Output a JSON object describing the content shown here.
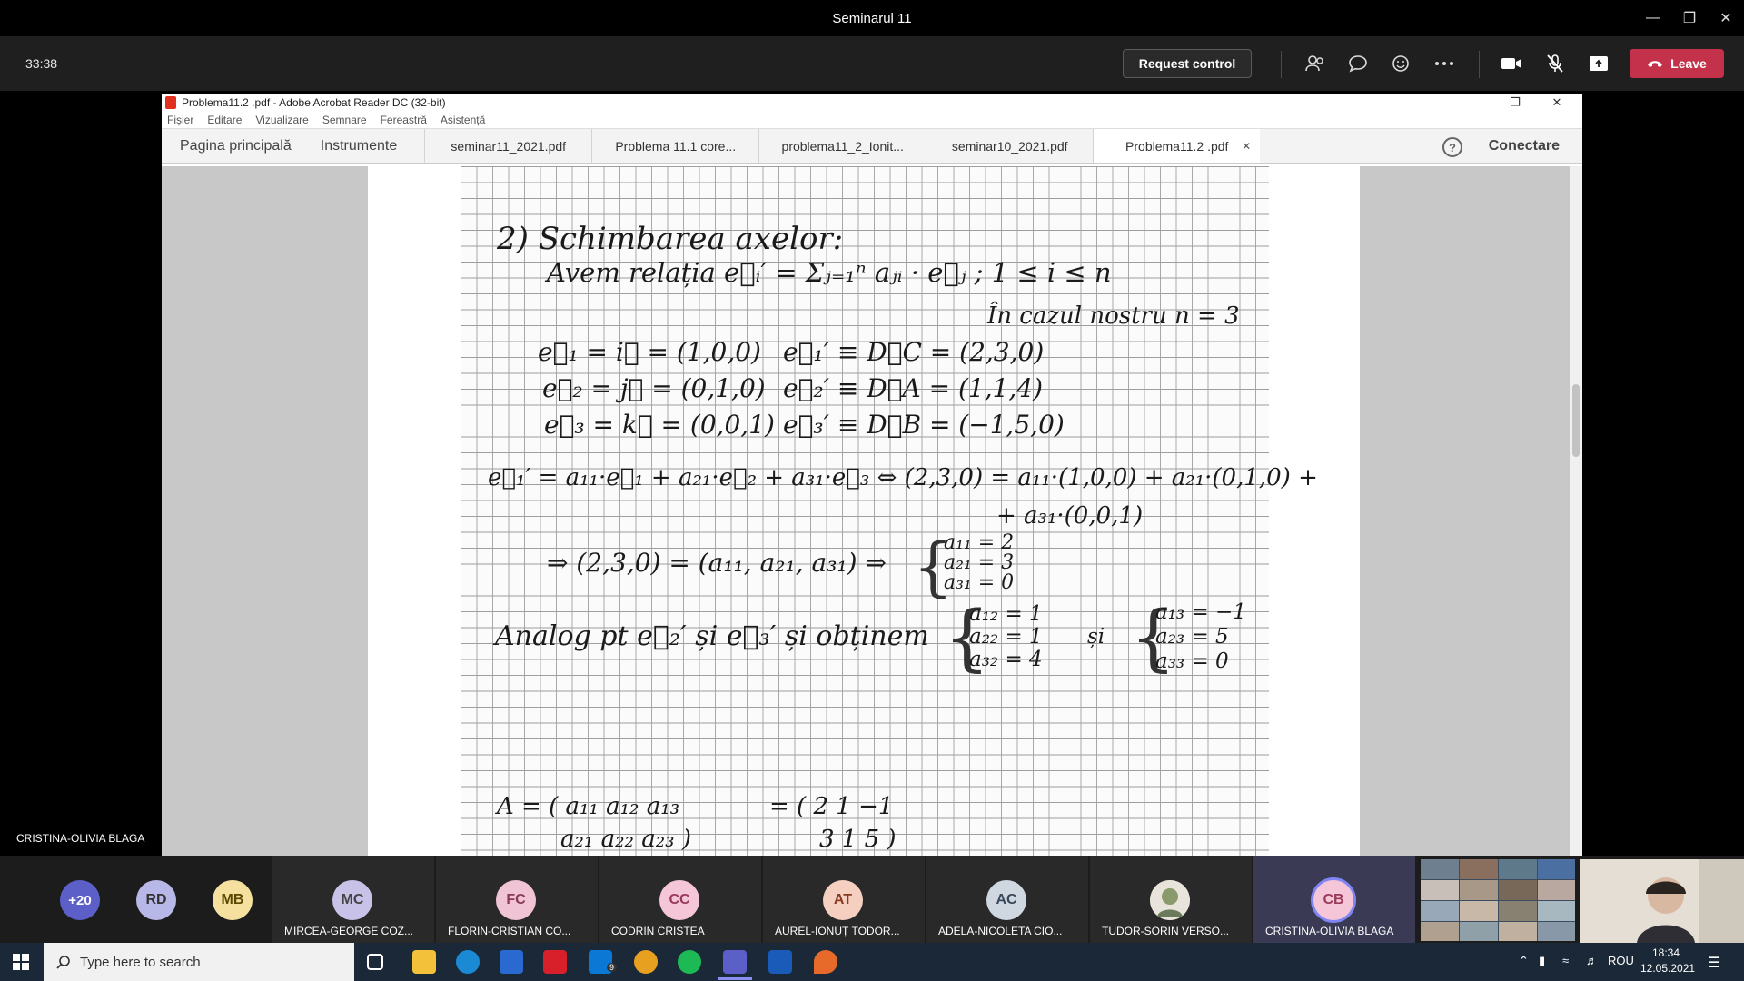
{
  "window": {
    "title": "Seminarul 11"
  },
  "meeting": {
    "timer": "33:38",
    "request_control": "Request control",
    "leave": "Leave",
    "presenter_name": "CRISTINA-OLIVIA BLAGA"
  },
  "acrobat": {
    "title": "Problema11.2 .pdf - Adobe Acrobat Reader DC (32-bit)",
    "menu": [
      "Fișier",
      "Editare",
      "Vizualizare",
      "Semnare",
      "Fereastră",
      "Asistență"
    ],
    "nav": [
      "Pagina principală",
      "Instrumente"
    ],
    "tabs": [
      "seminar11_2021.pdf",
      "Problema 11.1 core...",
      "problema11_2_Ionit...",
      "seminar10_2021.pdf",
      "Problema11.2 .pdf"
    ],
    "help": "?",
    "connect": "Conectare"
  },
  "handwriting": [
    "2) Schimbarea axelor:",
    "Avem relația   e⃗ᵢ′ = Σⱼ₌₁ⁿ aⱼᵢ · e⃗ⱼ   ;  1 ≤ i ≤ n",
    "În cazul nostru  n = 3",
    "e⃗₁ = i⃗ = (1,0,0)",
    "e⃗₂ = j⃗ = (0,1,0)",
    "e⃗₃ = k⃗ = (0,0,1)",
    "e⃗₁′ ≡ D⃗C = (2,3,0)",
    "e⃗₂′ ≡ D⃗A = (1,1,4)",
    "e⃗₃′ ≡ D⃗B = (−1,5,0)",
    "e⃗₁′ = a₁₁·e⃗₁ + a₂₁·e⃗₂ + a₃₁·e⃗₃ ⇔ (2,3,0) = a₁₁·(1,0,0) + a₂₁·(0,1,0) +",
    "+ a₃₁·(0,0,1)",
    "⇒ (2,3,0) = (a₁₁, a₂₁, a₃₁) ⇒",
    "a₁₁ = 2",
    "a₂₁ = 3",
    "a₃₁ = 0",
    "Analog pt e⃗₂′ și e⃗₃′ și obținem",
    "a₁₂ = 1",
    "a₂₂ = 1",
    "a₃₂ = 4",
    "și",
    "a₁₃ = −1",
    "a₂₃ = 5",
    "a₃₃ = 0",
    "A = ( a₁₁  a₁₂  a₁₃",
    "a₂₁  a₂₂  a₂₃ )",
    "= ( 2   1   −1",
    "3   1   5 )"
  ],
  "participants": {
    "overflow": "+20",
    "small": [
      {
        "initials": "RD",
        "color": "#b8b8e8"
      },
      {
        "initials": "MB",
        "color": "#f5e0a0"
      }
    ],
    "tiles": [
      {
        "initials": "MC",
        "name": "MIRCEA-GEORGE COZ...",
        "color": "#c9c2e8"
      },
      {
        "initials": "FC",
        "name": "FLORIN-CRISTIAN CO...",
        "color": "#f0c4d4"
      },
      {
        "initials": "CC",
        "name": "CODRIN CRISTEA",
        "color": "#f5c6d8"
      },
      {
        "initials": "AT",
        "name": "AUREL-IONUȚ TODOR...",
        "color": "#f5d0c0"
      },
      {
        "initials": "AC",
        "name": "ADELA-NICOLETA CIO...",
        "color": "#cfd8e0"
      },
      {
        "initials": "",
        "name": "TUDOR-SORIN VERSO...",
        "color": "#d8d0c0"
      },
      {
        "initials": "CB",
        "name": "CRISTINA-OLIVIA BLAGA",
        "color": "#f5c6d8"
      }
    ]
  },
  "taskbar": {
    "search_placeholder": "Type here to search",
    "language": "ROU",
    "time": "18:34",
    "date": "12.05.2021",
    "mail_badge": "9"
  }
}
